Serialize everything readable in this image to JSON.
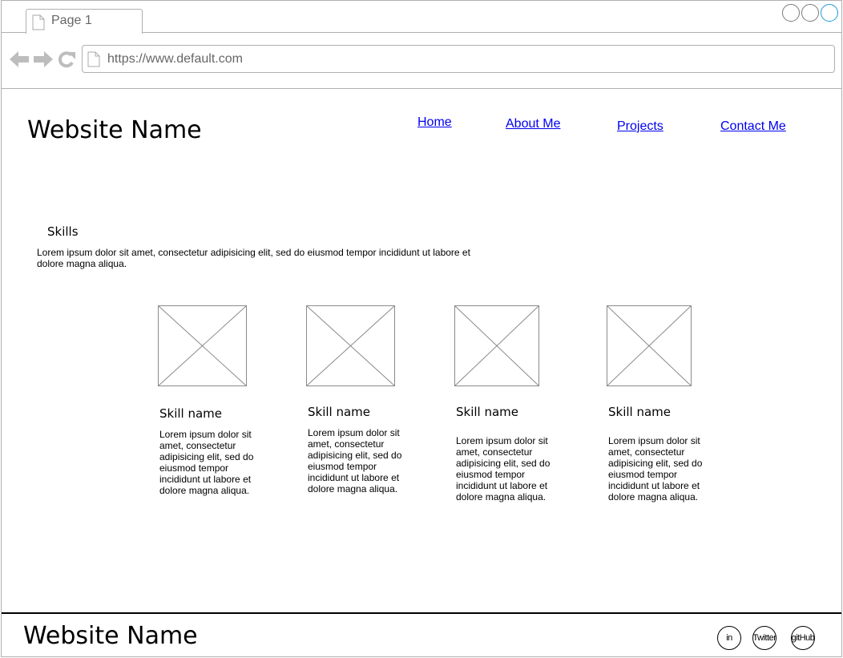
{
  "browser": {
    "tab_label": "Page 1",
    "url": "https://www.default.com"
  },
  "site": {
    "title": "Website Name",
    "nav": [
      {
        "label": "Home"
      },
      {
        "label": "About Me"
      },
      {
        "label": "Projects"
      },
      {
        "label": "Contact Me"
      }
    ]
  },
  "skills": {
    "heading": "Skills",
    "intro": "Lorem ipsum dolor sit amet, consectetur adipisicing elit, sed do eiusmod tempor incididunt ut labore et dolore magna aliqua.",
    "items": [
      {
        "name": "Skill name",
        "description": "Lorem ipsum dolor sit amet, consectetur adipisicing elit, sed do eiusmod tempor incididunt ut labore et dolore magna aliqua."
      },
      {
        "name": "Skill name",
        "description": "Lorem ipsum dolor sit amet, consectetur adipisicing elit, sed do eiusmod tempor incididunt ut labore et dolore magna aliqua."
      },
      {
        "name": "Skill name",
        "description": "Lorem ipsum dolor sit amet, consectetur adipisicing elit, sed do eiusmod tempor incididunt ut labore et dolore magna aliqua."
      },
      {
        "name": "Skill name",
        "description": "Lorem ipsum dolor sit amet, consectetur adipisicing elit, sed do eiusmod tempor incididunt ut labore et dolore magna aliqua."
      }
    ]
  },
  "footer": {
    "title": "Website Name",
    "social": [
      {
        "label": "in"
      },
      {
        "label": "Twitter"
      },
      {
        "label": "gitHub"
      }
    ]
  },
  "colors": {
    "link": "#0000ee",
    "border": "#b0b0b0",
    "active_control": "#1a9ad6"
  },
  "icons": [
    "page-icon",
    "back-arrow-icon",
    "forward-arrow-icon",
    "reload-icon",
    "image-placeholder-icon"
  ]
}
